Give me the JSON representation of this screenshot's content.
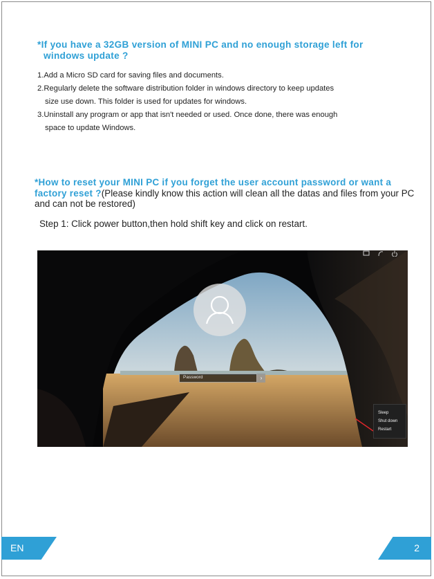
{
  "section1": {
    "heading_line1": "*If you have a 32GB version of MINI PC and no enough storage left for",
    "heading_line2": "windows update ?",
    "items": [
      {
        "line1": "1.Add a Micro SD card for saving files and documents.",
        "line2": ""
      },
      {
        "line1": "2.Regularly delete the software distribution folder in windows directory to keep updates",
        "line2": "size  use down. This folder is used for updates for windows."
      },
      {
        "line1": "3.Uninstall any program or app that isn't needed or used. Once done, there was enough",
        "line2": "space  to update Windows."
      }
    ]
  },
  "section2": {
    "heading": "*How to reset your MINI PC if you forget the user account password or want a factory reset ?",
    "note": "(Please kindly know this action will clean all the datas and files from your PC and can not be restored)",
    "step1": "Step 1: Click power button,then hold shift key and click on restart."
  },
  "screenshot": {
    "password_placeholder": "Password",
    "submit_glyph": "›",
    "power_menu": {
      "sleep": "Sleep",
      "shut_down": "Shut down",
      "restart": "Restart"
    },
    "icons": [
      "network-icon",
      "accessibility-icon",
      "power-icon",
      "user-avatar-icon"
    ]
  },
  "footer": {
    "language": "EN",
    "page_number": "2"
  },
  "colors": {
    "accent": "#2fa0d6",
    "body_text": "#222222",
    "highlight_line": "#e0262b"
  }
}
